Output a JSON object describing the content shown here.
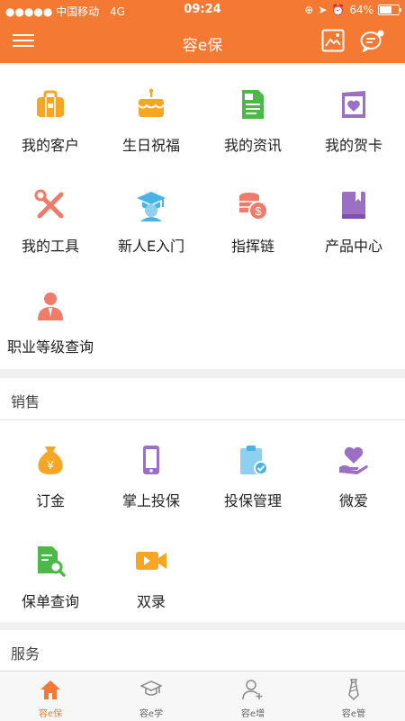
{
  "status_bar": {
    "carrier": "●●●●● 中国移动",
    "network": "4G",
    "time": "09:24",
    "battery": "64%"
  },
  "header": {
    "title": "容e保"
  },
  "sections": {
    "main": [
      {
        "label": "我的客户",
        "icon": "briefcase-icon",
        "color": "#f5a623"
      },
      {
        "label": "生日祝福",
        "icon": "cake-icon",
        "color": "#f5a623"
      },
      {
        "label": "我的资讯",
        "icon": "document-icon",
        "color": "#4cb848"
      },
      {
        "label": "我的贺卡",
        "icon": "card-icon",
        "color": "#9b6fc4"
      },
      {
        "label": "我的工具",
        "icon": "tools-icon",
        "color": "#ef7b6a"
      },
      {
        "label": "新人E入门",
        "icon": "graduate-icon",
        "color": "#4ab3e5"
      },
      {
        "label": "指挥链",
        "icon": "coins-icon",
        "color": "#ef7b6a"
      },
      {
        "label": "产品中心",
        "icon": "book-icon",
        "color": "#9b6fc4"
      },
      {
        "label": "职业等级查询",
        "icon": "person-icon",
        "color": "#ef7b6a"
      }
    ],
    "sales": {
      "title": "销售",
      "items": [
        {
          "label": "订金",
          "icon": "money-bag-icon",
          "color": "#f5a623"
        },
        {
          "label": "掌上投保",
          "icon": "phone-icon",
          "color": "#9b6fc4"
        },
        {
          "label": "投保管理",
          "icon": "clipboard-icon",
          "color": "#4ab3e5"
        },
        {
          "label": "微爱",
          "icon": "heart-hand-icon",
          "color": "#9b6fc4"
        },
        {
          "label": "保单查询",
          "icon": "search-doc-icon",
          "color": "#4cb848"
        },
        {
          "label": "双录",
          "icon": "video-icon",
          "color": "#f5a623"
        }
      ]
    },
    "service": {
      "title": "服务"
    }
  },
  "tabs": [
    {
      "label": "容e保",
      "icon": "home-icon",
      "active": true
    },
    {
      "label": "容e学",
      "icon": "graduation-cap-icon",
      "active": false
    },
    {
      "label": "容e增",
      "icon": "add-user-icon",
      "active": false
    },
    {
      "label": "容e管",
      "icon": "tie-icon",
      "active": false
    }
  ],
  "colors": {
    "brand": "#f47a34"
  }
}
